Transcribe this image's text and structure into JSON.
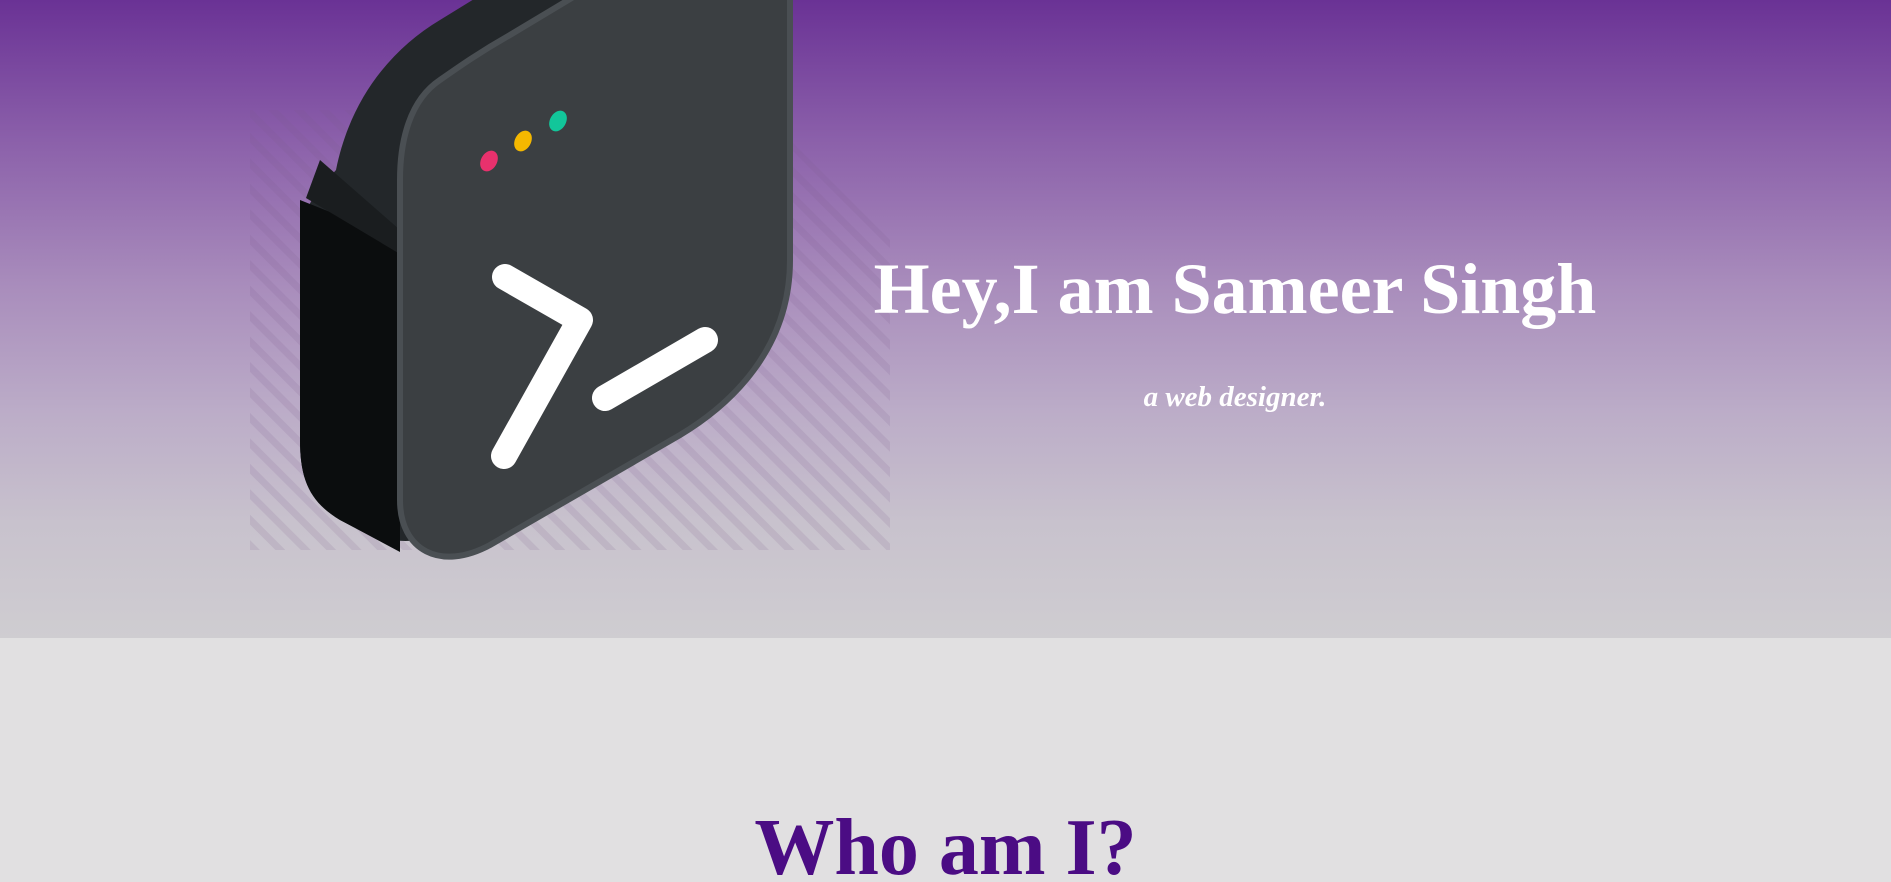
{
  "hero": {
    "title": "Hey,I am Sameer Singh",
    "subtitle": "a web designer.",
    "illustration_icon": "terminal-prompt-icon",
    "window_dots": [
      "#e8316d",
      "#f5b800",
      "#12c69a"
    ]
  },
  "about": {
    "title": "Who am I?"
  },
  "colors": {
    "hero_gradient_top": "#6a3295",
    "hero_gradient_bottom": "#cfcdd1",
    "page_background": "#e1e0e1",
    "about_title": "#4b0c84"
  }
}
